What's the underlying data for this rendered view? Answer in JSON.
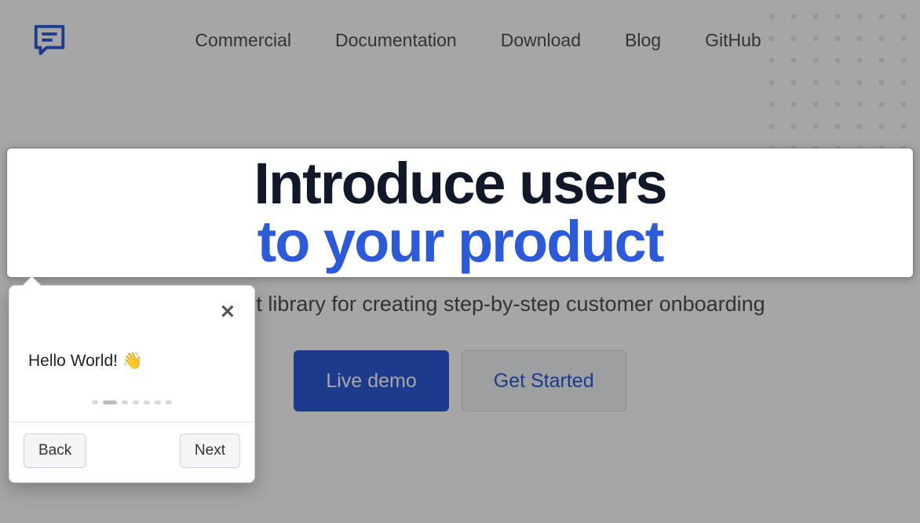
{
  "nav": {
    "items": [
      "Commercial",
      "Documentation",
      "Download",
      "Blog",
      "GitHub"
    ]
  },
  "hero": {
    "line1": "Introduce users",
    "line2": "to your product"
  },
  "subhead": "Lightweight library for creating step-by-step customer onboarding",
  "cta": {
    "primary": "Live demo",
    "secondary": "Get Started"
  },
  "popover": {
    "message": "Hello World! 👋",
    "back": "Back",
    "next": "Next",
    "steps_total": 7,
    "step_active_index": 1
  }
}
